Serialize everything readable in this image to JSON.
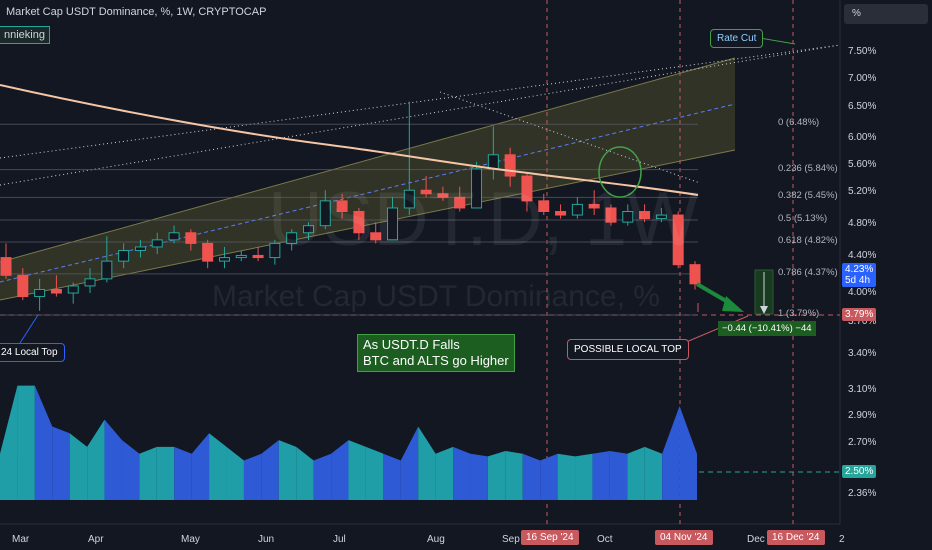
{
  "header": {
    "title": "Market Cap USDT Dominance, %, 1W, CRYPTOCAP",
    "author": "nnieking",
    "unit_box": "%"
  },
  "watermark": {
    "symbol": "USDT.D, 1W",
    "name": "Market Cap USDT Dominance, %"
  },
  "price_axis": {
    "ticks": [
      "7.50%",
      "7.00%",
      "6.50%",
      "6.00%",
      "5.60%",
      "5.20%",
      "4.80%",
      "4.40%",
      "4.00%",
      "3.70%",
      "3.40%",
      "3.10%",
      "2.90%",
      "2.70%",
      "2.36%"
    ],
    "current": {
      "value": "4.23%",
      "countdown": "5d 4h",
      "color": "#2962ff"
    },
    "target": {
      "value": "3.79%",
      "color": "#c7595f"
    },
    "volume_tag": {
      "value": "2.50%",
      "color": "#26a69a"
    }
  },
  "fib_levels": [
    {
      "label": "0 (6.48%)",
      "value": 6.48
    },
    {
      "label": "0.236 (5.84%)",
      "value": 5.84
    },
    {
      "label": "0.382 (5.45%)",
      "value": 5.45
    },
    {
      "label": "0.5 (5.13%)",
      "value": 5.13
    },
    {
      "label": "0.618 (4.82%)",
      "value": 4.82
    },
    {
      "label": "0.786 (4.37%)",
      "value": 4.37
    },
    {
      "label": "1 (3.79%)",
      "value": 3.79
    }
  ],
  "time_axis": {
    "labels": [
      "Mar",
      "Apr",
      "May",
      "Jun",
      "Jul",
      "Aug",
      "Sep",
      "Oct",
      "Dec",
      "2"
    ],
    "highlighted": [
      "16 Sep '24",
      "04 Nov '24",
      "16 Dec '24"
    ]
  },
  "annotations": {
    "green_box": [
      "As USDT.D Falls",
      "BTC and ALTS go Higher"
    ],
    "possible_local_top": "POSSIBLE LOCAL TOP",
    "rate_cut": "Rate Cut",
    "left_label": "24 Local Top",
    "measurement": "−0.44 (−10.41%) −44"
  },
  "colors": {
    "up": "#26a69a",
    "down": "#ef5350",
    "channel_fill": "#4a4a2a",
    "ma_line": "#f5c6a5",
    "fib_line": "#5d606b",
    "volume_teal": "#1f9ea7",
    "volume_blue": "#2e5ad6"
  },
  "chart_data": {
    "type": "candlestick",
    "interval": "1W",
    "ylim": [
      3.65,
      7.7
    ],
    "candles": [
      {
        "o": 4.6,
        "h": 4.8,
        "l": 4.3,
        "c": 4.35
      },
      {
        "o": 4.35,
        "h": 4.45,
        "l": 4.0,
        "c": 4.05
      },
      {
        "o": 4.05,
        "h": 4.3,
        "l": 3.85,
        "c": 4.15
      },
      {
        "o": 4.15,
        "h": 4.35,
        "l": 4.05,
        "c": 4.1
      },
      {
        "o": 4.1,
        "h": 4.25,
        "l": 3.95,
        "c": 4.2
      },
      {
        "o": 4.2,
        "h": 4.45,
        "l": 4.1,
        "c": 4.3
      },
      {
        "o": 4.3,
        "h": 4.9,
        "l": 4.25,
        "c": 4.55
      },
      {
        "o": 4.55,
        "h": 4.8,
        "l": 4.45,
        "c": 4.7
      },
      {
        "o": 4.7,
        "h": 4.85,
        "l": 4.6,
        "c": 4.75
      },
      {
        "o": 4.75,
        "h": 4.95,
        "l": 4.65,
        "c": 4.85
      },
      {
        "o": 4.85,
        "h": 5.05,
        "l": 4.8,
        "c": 4.95
      },
      {
        "o": 4.95,
        "h": 5.0,
        "l": 4.7,
        "c": 4.8
      },
      {
        "o": 4.8,
        "h": 4.85,
        "l": 4.45,
        "c": 4.55
      },
      {
        "o": 4.55,
        "h": 4.75,
        "l": 4.45,
        "c": 4.6
      },
      {
        "o": 4.6,
        "h": 4.7,
        "l": 4.55,
        "c": 4.63
      },
      {
        "o": 4.63,
        "h": 4.75,
        "l": 4.55,
        "c": 4.6
      },
      {
        "o": 4.6,
        "h": 4.85,
        "l": 4.5,
        "c": 4.8
      },
      {
        "o": 4.8,
        "h": 5.0,
        "l": 4.7,
        "c": 4.95
      },
      {
        "o": 4.95,
        "h": 5.1,
        "l": 4.85,
        "c": 5.05
      },
      {
        "o": 5.05,
        "h": 5.55,
        "l": 5.0,
        "c": 5.4
      },
      {
        "o": 5.4,
        "h": 5.5,
        "l": 5.15,
        "c": 5.25
      },
      {
        "o": 5.25,
        "h": 5.3,
        "l": 4.85,
        "c": 4.95
      },
      {
        "o": 4.95,
        "h": 5.1,
        "l": 4.8,
        "c": 4.85
      },
      {
        "o": 4.85,
        "h": 5.45,
        "l": 4.85,
        "c": 5.3
      },
      {
        "o": 5.3,
        "h": 6.8,
        "l": 5.2,
        "c": 5.55
      },
      {
        "o": 5.55,
        "h": 5.75,
        "l": 5.45,
        "c": 5.5
      },
      {
        "o": 5.5,
        "h": 5.6,
        "l": 5.4,
        "c": 5.45
      },
      {
        "o": 5.45,
        "h": 5.6,
        "l": 5.25,
        "c": 5.3
      },
      {
        "o": 5.3,
        "h": 5.95,
        "l": 5.3,
        "c": 5.85
      },
      {
        "o": 5.85,
        "h": 6.45,
        "l": 5.7,
        "c": 6.05
      },
      {
        "o": 6.05,
        "h": 6.15,
        "l": 5.6,
        "c": 5.75
      },
      {
        "o": 5.75,
        "h": 5.8,
        "l": 5.25,
        "c": 5.4
      },
      {
        "o": 5.4,
        "h": 5.5,
        "l": 5.2,
        "c": 5.25
      },
      {
        "o": 5.25,
        "h": 5.35,
        "l": 5.15,
        "c": 5.2
      },
      {
        "o": 5.2,
        "h": 5.45,
        "l": 5.15,
        "c": 5.35
      },
      {
        "o": 5.35,
        "h": 5.55,
        "l": 5.2,
        "c": 5.3
      },
      {
        "o": 5.3,
        "h": 5.35,
        "l": 5.05,
        "c": 5.1
      },
      {
        "o": 5.1,
        "h": 5.35,
        "l": 5.05,
        "c": 5.25
      },
      {
        "o": 5.25,
        "h": 5.35,
        "l": 5.1,
        "c": 5.15
      },
      {
        "o": 5.15,
        "h": 5.3,
        "l": 5.1,
        "c": 5.2
      },
      {
        "o": 5.2,
        "h": 5.25,
        "l": 4.45,
        "c": 4.5
      },
      {
        "o": 4.5,
        "h": 4.55,
        "l": 4.15,
        "c": 4.23
      }
    ],
    "volume": [
      2.7,
      3.2,
      3.2,
      2.9,
      2.85,
      2.75,
      2.95,
      2.8,
      2.7,
      2.75,
      2.75,
      2.7,
      2.85,
      2.75,
      2.65,
      2.7,
      2.8,
      2.75,
      2.65,
      2.7,
      2.8,
      2.75,
      2.7,
      2.65,
      2.9,
      2.7,
      2.75,
      2.7,
      2.68,
      2.72,
      2.7,
      2.65,
      2.7,
      2.68,
      2.7,
      2.72,
      2.7,
      2.75,
      2.7,
      3.05,
      2.7
    ],
    "volume_ylim": [
      2.36,
      3.3
    ]
  }
}
